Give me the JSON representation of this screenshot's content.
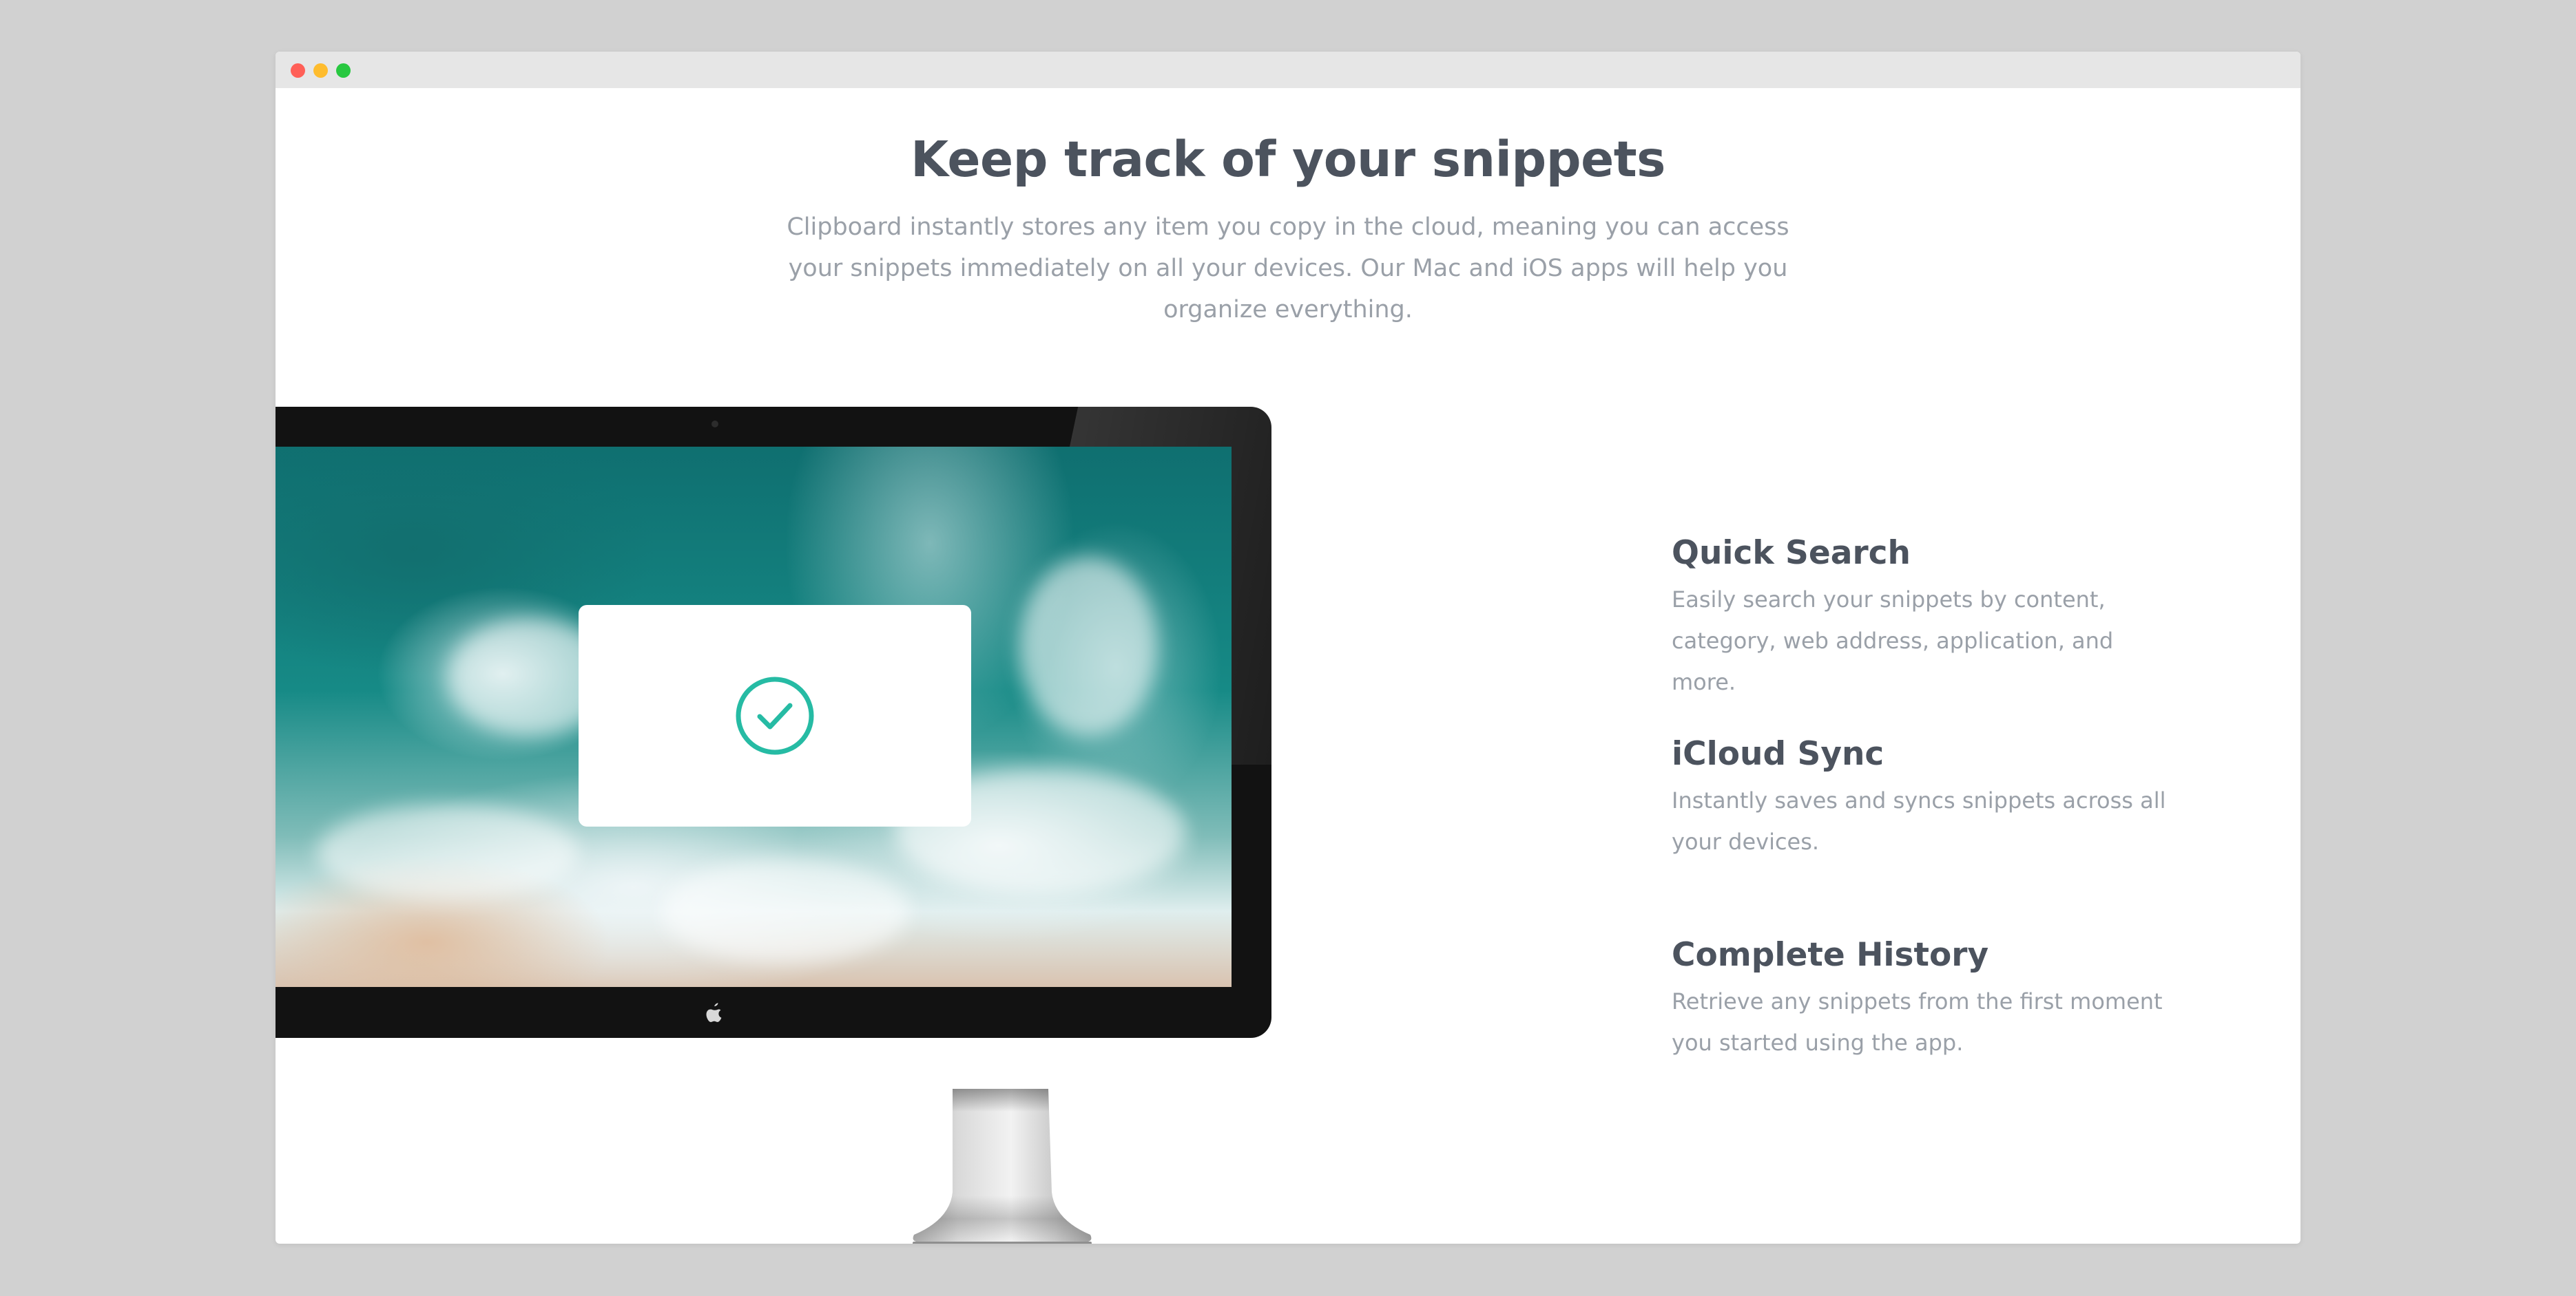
{
  "window": {
    "controls": [
      "close",
      "minimize",
      "maximize"
    ]
  },
  "section": {
    "heading": "Keep track of your snippets",
    "intro": "Clipboard instantly stores any item you copy in the cloud, meaning you can access your snippets immediately on all your devices. Our Mac and iOS apps will help you organize everything."
  },
  "illustration": {
    "device": "desktop-monitor",
    "screen_icon": "check-circle-icon",
    "accent_color": "#26bba4"
  },
  "features": [
    {
      "title": "Quick Search",
      "description": "Easily search your snippets by content, category, web address, application, and more."
    },
    {
      "title": "iCloud Sync",
      "description": "Instantly saves and syncs snippets across all your devices."
    },
    {
      "title": "Complete History",
      "description": "Retrieve any snippets from the first moment you started using the app."
    }
  ],
  "colors": {
    "heading": "#4c535e",
    "body_text": "#9aa0a8",
    "page_background": "#d1d1d1"
  }
}
